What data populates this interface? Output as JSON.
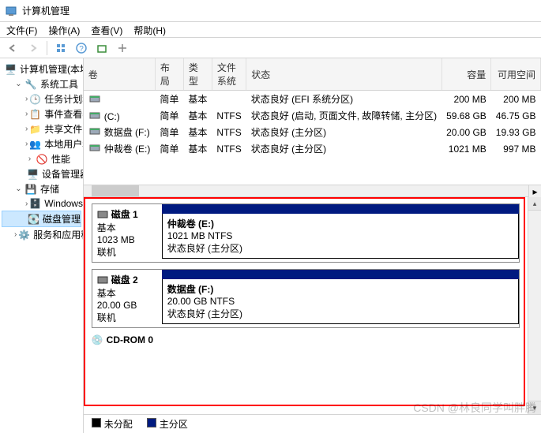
{
  "title": "计算机管理",
  "menu": {
    "file": "文件(F)",
    "action": "操作(A)",
    "view": "查看(V)",
    "help": "帮助(H)"
  },
  "tree": {
    "root": "计算机管理(本地)",
    "system": "系统工具",
    "system_children": {
      "scheduler": "任务计划程序",
      "eventvwr": "事件查看器",
      "shared": "共享文件夹",
      "users": "本地用户和组",
      "perf": "性能",
      "devmgr": "设备管理器"
    },
    "storage": "存储",
    "storage_children": {
      "wsb": "Windows Server Back",
      "diskmgmt": "磁盘管理"
    },
    "services": "服务和应用程序"
  },
  "table": {
    "headers": {
      "volume": "卷",
      "layout": "布局",
      "type": "类型",
      "fs": "文件系统",
      "status": "状态",
      "capacity": "容量",
      "free": "可用空间"
    },
    "rows": [
      {
        "volume": "",
        "layout": "简单",
        "type": "基本",
        "fs": "",
        "status": "状态良好 (EFI 系统分区)",
        "capacity": "200 MB",
        "free": "200 MB"
      },
      {
        "volume": "(C:)",
        "layout": "简单",
        "type": "基本",
        "fs": "NTFS",
        "status": "状态良好 (启动, 页面文件, 故障转储, 主分区)",
        "capacity": "59.68 GB",
        "free": "46.75 GB"
      },
      {
        "volume": "数据盘 (F:)",
        "layout": "简单",
        "type": "基本",
        "fs": "NTFS",
        "status": "状态良好 (主分区)",
        "capacity": "20.00 GB",
        "free": "19.93 GB"
      },
      {
        "volume": "仲裁卷 (E:)",
        "layout": "简单",
        "type": "基本",
        "fs": "NTFS",
        "status": "状态良好 (主分区)",
        "capacity": "1021 MB",
        "free": "997 MB"
      }
    ]
  },
  "disks": [
    {
      "name": "磁盘 1",
      "type": "基本",
      "size": "1023 MB",
      "status": "联机",
      "part": {
        "title": "仲裁卷  (E:)",
        "detail": "1021 MB NTFS",
        "state": "状态良好 (主分区)"
      }
    },
    {
      "name": "磁盘 2",
      "type": "基本",
      "size": "20.00 GB",
      "status": "联机",
      "part": {
        "title": "数据盘  (F:)",
        "detail": "20.00 GB NTFS",
        "state": "状态良好 (主分区)"
      }
    }
  ],
  "cdrom": "CD-ROM 0",
  "legend": {
    "unalloc": "未分配",
    "primary": "主分区"
  },
  "watermark": "CSDN @林良同学叫胖腾"
}
